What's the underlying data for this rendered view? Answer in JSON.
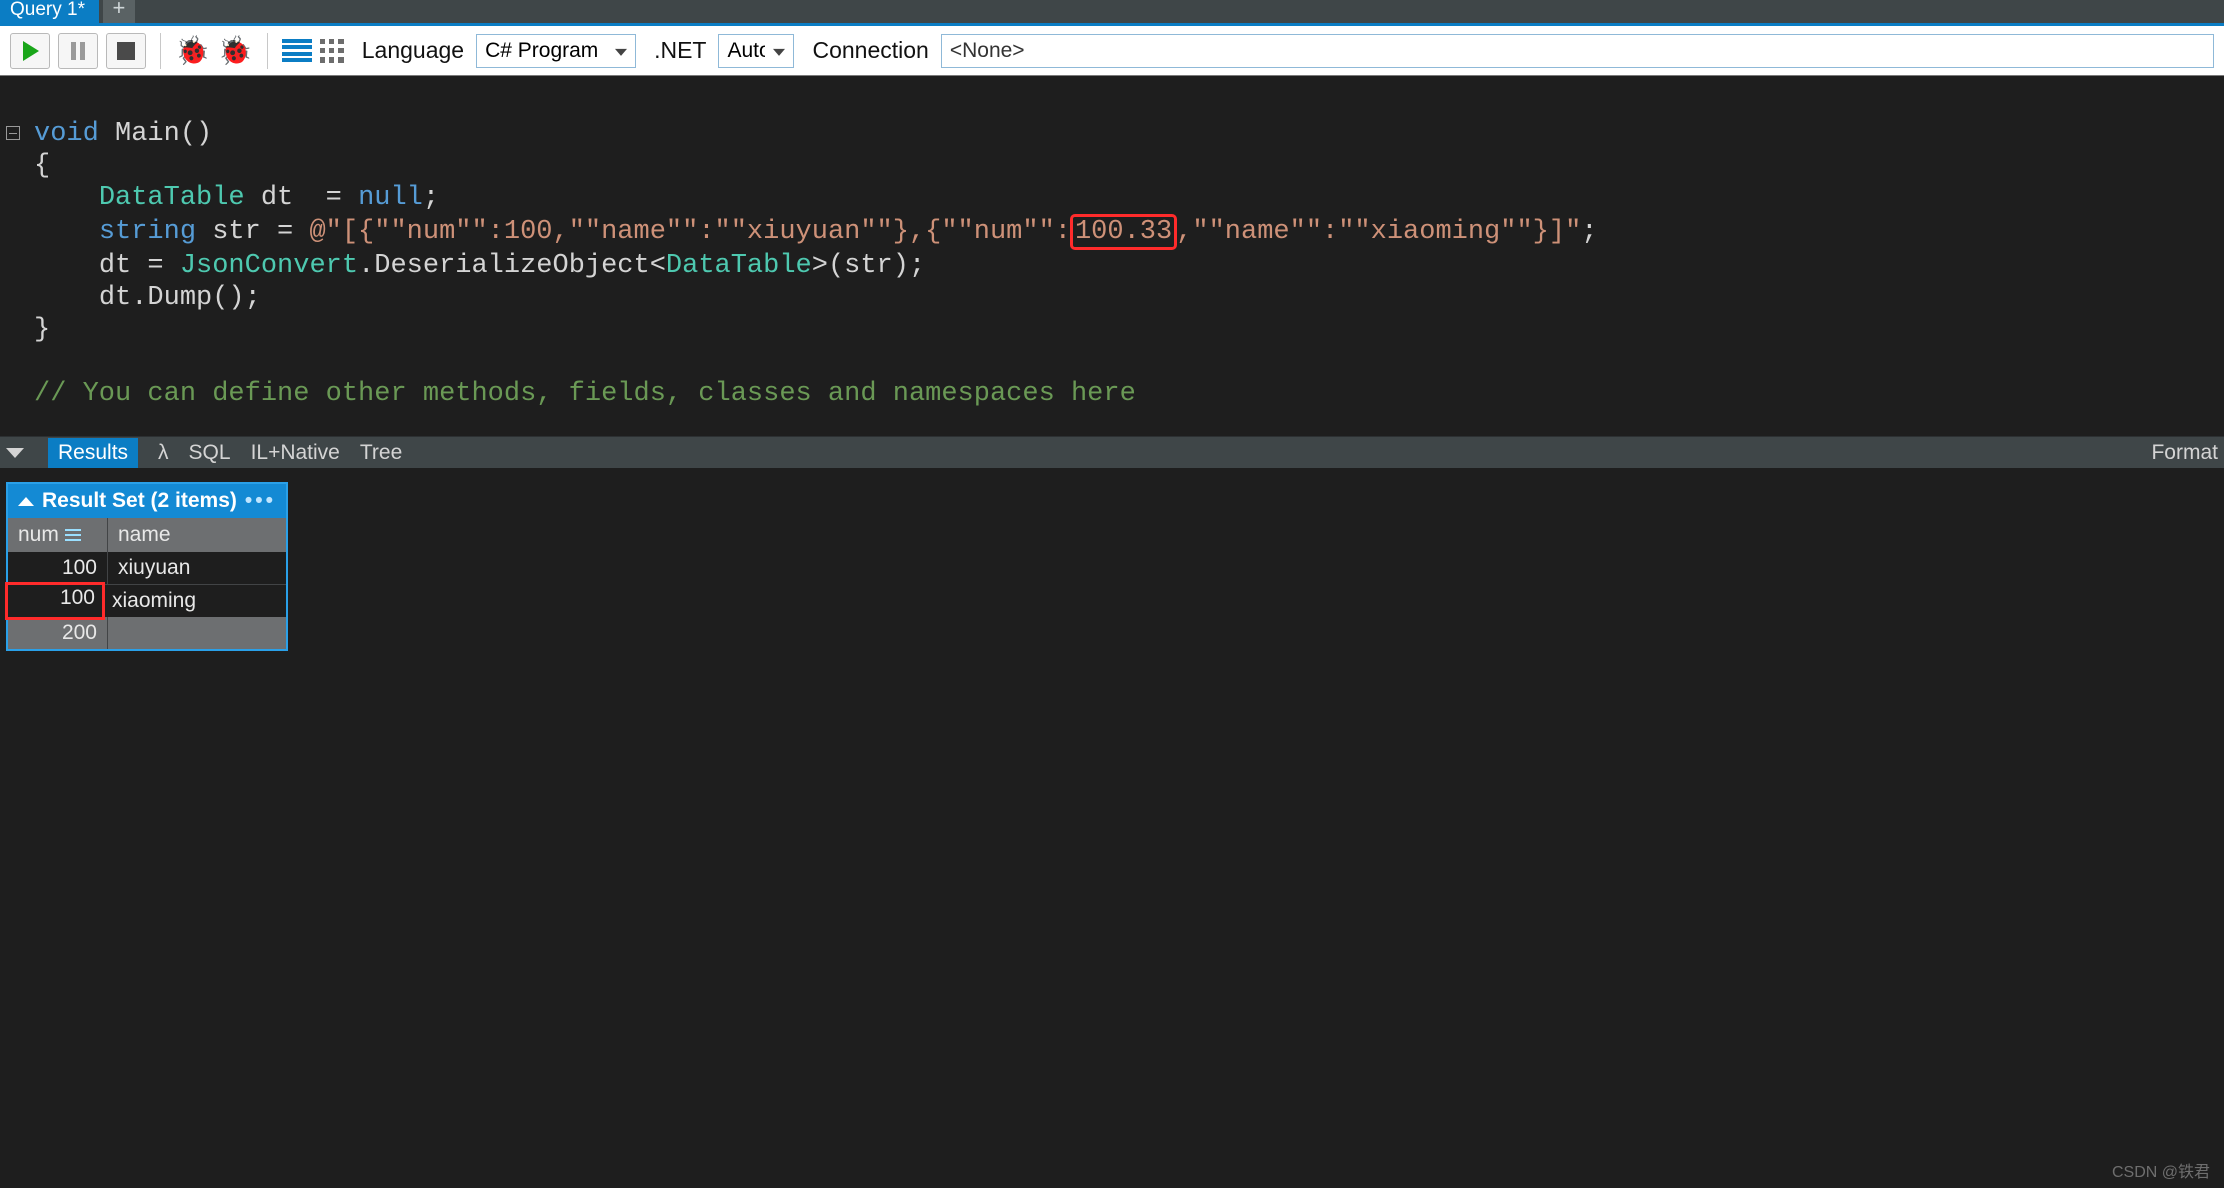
{
  "tabs": {
    "active": "Query 1*",
    "add_tooltip": "New query"
  },
  "toolbar": {
    "language_label": "Language",
    "language_value": "C# Program",
    "net_label": ".NET",
    "net_value": "Auto",
    "connection_label": "Connection",
    "connection_value": "<None>"
  },
  "code": {
    "l1_kw1": "void",
    "l1_name": " Main()",
    "l2": "{",
    "l3_type": "DataTable",
    "l3_rest": " dt  = ",
    "l3_null": "null",
    "l3_semi": ";",
    "l4_kw": "string",
    "l4_a": " str = ",
    "l4_str_a": "@\"[{\"\"num\"\":100,\"\"name\"\":\"\"xiuyuan\"\"},{\"\"num\"\":",
    "l4_hl": "100.33",
    "l4_str_b": ",\"\"name\"\":\"\"xiaoming\"\"}]\"",
    "l4_semi": ";",
    "l5_a": "dt = ",
    "l5_type1": "JsonConvert",
    "l5_b": ".DeserializeObject<",
    "l5_type2": "DataTable",
    "l5_c": ">(str);",
    "l6": "dt.Dump();",
    "l7": "}",
    "comment": "// You can define other methods, fields, classes and namespaces here"
  },
  "results_tabs": {
    "t0": "Results",
    "t1": "λ",
    "t2": "SQL",
    "t3": "IL+Native",
    "t4": "Tree",
    "format": "Format"
  },
  "grid": {
    "title": "Result Set (2 items)",
    "columns": {
      "c0": "num",
      "c1": "name"
    },
    "rows": [
      {
        "num": "100",
        "name": "xiuyuan",
        "hl": false
      },
      {
        "num": "100",
        "name": "xiaoming",
        "hl": true
      }
    ],
    "footer_total": "200"
  },
  "watermark": "CSDN @铁君"
}
